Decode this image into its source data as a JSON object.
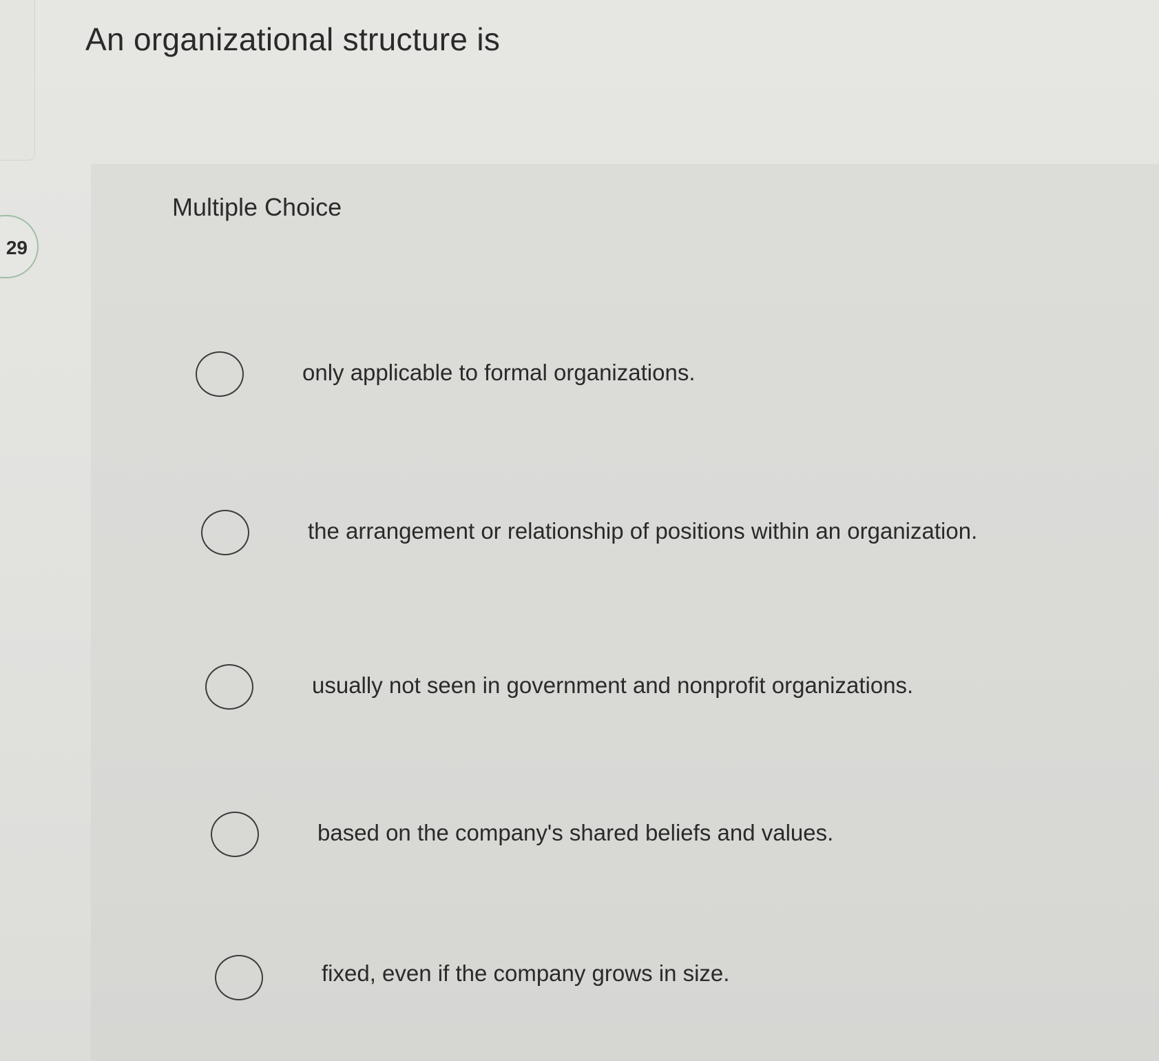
{
  "question": {
    "number": "29",
    "text": "An organizational structure is"
  },
  "panel": {
    "label": "Multiple Choice"
  },
  "options": [
    {
      "label": "only applicable to formal organizations."
    },
    {
      "label": "the arrangement or relationship of positions within an organization."
    },
    {
      "label": "usually not seen in government and nonprofit organizations."
    },
    {
      "label": "based on the company's shared beliefs and values."
    },
    {
      "label": "fixed, even if the company grows in size."
    }
  ]
}
